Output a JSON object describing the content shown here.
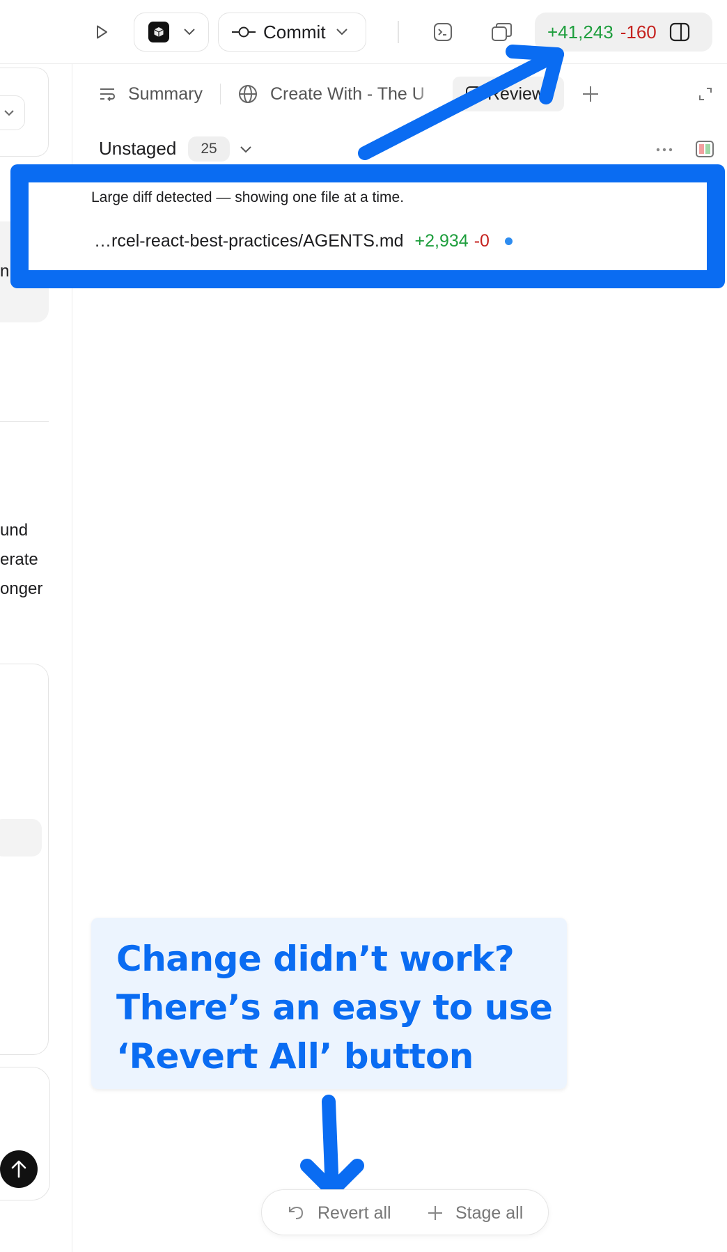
{
  "toolbar": {
    "run_icon": "play-icon",
    "app_icon": "cube-app-icon",
    "commit_label": "Commit",
    "terminal_icon": "terminal-icon",
    "copy_icon": "copy-window-icon",
    "additions": "+41,243",
    "deletions": "-160",
    "panel_icon": "sidebar-toggle-icon"
  },
  "left_panel": {
    "snippets": [
      "n",
      "und",
      "erate",
      "onger"
    ]
  },
  "tabs": [
    {
      "label": "Summary",
      "icon": "summary-list-icon"
    },
    {
      "label": "Create With - The U",
      "icon": "globe-icon"
    },
    {
      "label": "Review",
      "icon": "review-icon"
    }
  ],
  "unstaged": {
    "label": "Unstaged",
    "count": "25"
  },
  "diff": {
    "notice": "Large diff detected — showing one file at a time.",
    "file_name": "…rcel-react-best-practices/AGENTS.md",
    "additions": "+2,934",
    "deletions": "-0"
  },
  "callout": {
    "lines": [
      "Change didn’t work?",
      "There’s an easy to use",
      "‘Revert All’ button"
    ]
  },
  "actions": {
    "revert_label": "Revert all",
    "stage_label": "Stage all"
  },
  "colors": {
    "annotation_blue": "#0a6cf2",
    "addition_green": "#1e9e3d",
    "deletion_red": "#c5221f",
    "callout_bg": "#ecf4fe"
  }
}
